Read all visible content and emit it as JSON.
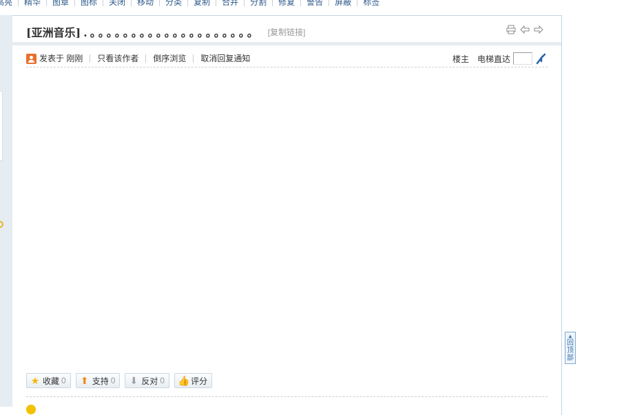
{
  "toolbar": {
    "items": [
      "高亮",
      "精华",
      "图章",
      "图标",
      "关闭",
      "移动",
      "分类",
      "复制",
      "合并",
      "分割",
      "修复",
      "警告",
      "屏蔽",
      "标签"
    ]
  },
  "post": {
    "title": "[亚洲音乐]",
    "title_dots": ".。。。。。。。。。。。。。。。。。。。。",
    "copy_link": "[复制链接]",
    "icons": [
      "print-icon",
      "prev-thread-icon",
      "next-thread-icon"
    ],
    "meta": {
      "posted_prefix": "发表于",
      "posted_time": "刚刚",
      "only_author": "只看该作者",
      "reverse_browse": "倒序浏览",
      "cancel_notify": "取消回复通知",
      "floor_label": "楼主",
      "elevator_label": "电梯直达",
      "elevator_value": ""
    },
    "actions": [
      {
        "label": "收藏",
        "count": "0",
        "icon": "star-icon"
      },
      {
        "label": "支持",
        "count": "0",
        "icon": "thumb-up-arrow-icon"
      },
      {
        "label": "反对",
        "count": "0",
        "icon": "thumb-down-arrow-icon"
      },
      {
        "label": "评分",
        "count": "",
        "icon": "rate-thumb-icon"
      }
    ]
  },
  "back_to_top": {
    "label": "回顶部"
  },
  "colors": {
    "link_blue": "#2d5a8a",
    "panel_border": "#c2d5e3",
    "header_bar": "#e5edf2",
    "accent_orange": "#e8702c"
  }
}
